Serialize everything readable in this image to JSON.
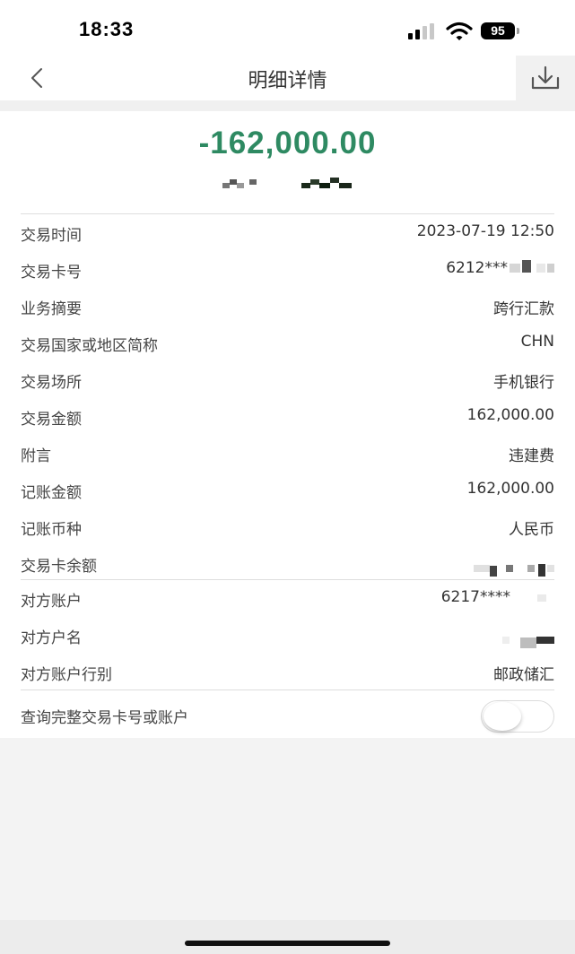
{
  "status_bar": {
    "time": "18:33",
    "battery": "95"
  },
  "nav": {
    "title": "明细详情",
    "back_icon": "chevron-left-icon",
    "download_icon": "download-icon"
  },
  "summary": {
    "amount": "-162,000.00"
  },
  "details": [
    {
      "label": "交易时间",
      "value": "2023-07-19 12:50"
    },
    {
      "label": "交易卡号",
      "value": "6212***"
    },
    {
      "label": "业务摘要",
      "value": "跨行汇款"
    },
    {
      "label": "交易国家或地区简称",
      "value": "CHN"
    },
    {
      "label": "交易场所",
      "value": "手机银行"
    },
    {
      "label": "交易金额",
      "value": "162,000.00"
    },
    {
      "label": "附言",
      "value": "违建费"
    },
    {
      "label": "记账金额",
      "value": "162,000.00"
    },
    {
      "label": "记账币种",
      "value": "人民币"
    },
    {
      "label": "交易卡余额",
      "value": ""
    }
  ],
  "counterparty": [
    {
      "label": "对方账户",
      "value": "6217****"
    },
    {
      "label": "对方户名",
      "value": ""
    },
    {
      "label": "对方账户行别",
      "value": "邮政储汇"
    }
  ],
  "toggle_row": {
    "label": "查询完整交易卡号或账户",
    "enabled": false
  },
  "colors": {
    "amount": "#2e8a62",
    "background": "#f3f3f3"
  }
}
